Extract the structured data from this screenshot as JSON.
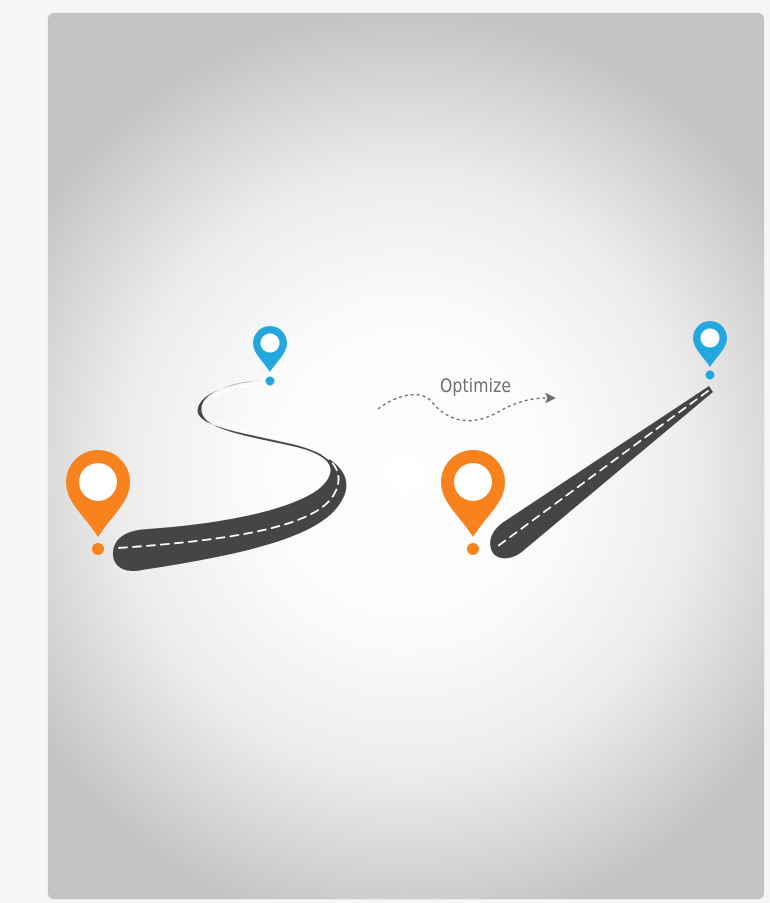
{
  "illustration": {
    "arrow_label": "Optimize",
    "colors": {
      "origin_pin": "#f7821e",
      "destination_pin": "#23a7df",
      "road": "#454545",
      "road_dash": "#ffffff",
      "arrow": "#6d6d6d"
    },
    "before": {
      "origin": "orange-location-pin",
      "destination": "blue-location-pin",
      "route": "winding-road"
    },
    "after": {
      "origin": "orange-location-pin",
      "destination": "blue-location-pin",
      "route": "straight-road"
    }
  }
}
